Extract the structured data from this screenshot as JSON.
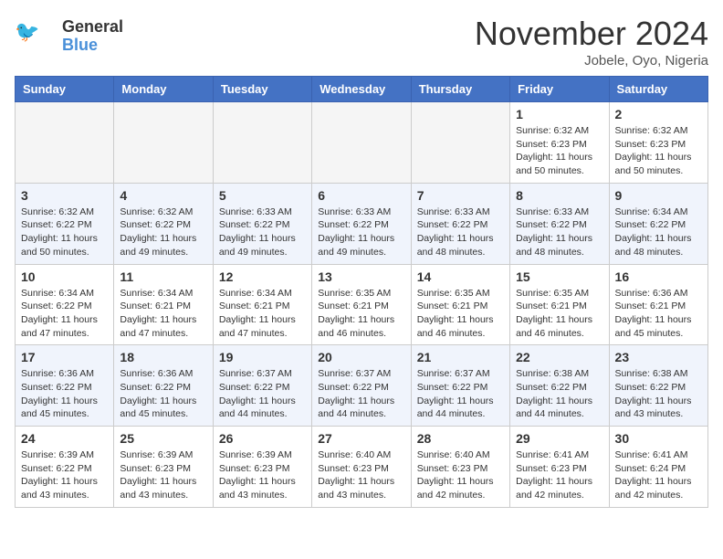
{
  "header": {
    "logo_line1": "General",
    "logo_line2": "Blue",
    "month_title": "November 2024",
    "location": "Jobele, Oyo, Nigeria"
  },
  "weekdays": [
    "Sunday",
    "Monday",
    "Tuesday",
    "Wednesday",
    "Thursday",
    "Friday",
    "Saturday"
  ],
  "weeks": [
    [
      {
        "day": "",
        "empty": true
      },
      {
        "day": "",
        "empty": true
      },
      {
        "day": "",
        "empty": true
      },
      {
        "day": "",
        "empty": true
      },
      {
        "day": "",
        "empty": true
      },
      {
        "day": "1",
        "info": "Sunrise: 6:32 AM\nSunset: 6:23 PM\nDaylight: 11 hours\nand 50 minutes."
      },
      {
        "day": "2",
        "info": "Sunrise: 6:32 AM\nSunset: 6:23 PM\nDaylight: 11 hours\nand 50 minutes."
      }
    ],
    [
      {
        "day": "3",
        "info": "Sunrise: 6:32 AM\nSunset: 6:22 PM\nDaylight: 11 hours\nand 50 minutes."
      },
      {
        "day": "4",
        "info": "Sunrise: 6:32 AM\nSunset: 6:22 PM\nDaylight: 11 hours\nand 49 minutes."
      },
      {
        "day": "5",
        "info": "Sunrise: 6:33 AM\nSunset: 6:22 PM\nDaylight: 11 hours\nand 49 minutes."
      },
      {
        "day": "6",
        "info": "Sunrise: 6:33 AM\nSunset: 6:22 PM\nDaylight: 11 hours\nand 49 minutes."
      },
      {
        "day": "7",
        "info": "Sunrise: 6:33 AM\nSunset: 6:22 PM\nDaylight: 11 hours\nand 48 minutes."
      },
      {
        "day": "8",
        "info": "Sunrise: 6:33 AM\nSunset: 6:22 PM\nDaylight: 11 hours\nand 48 minutes."
      },
      {
        "day": "9",
        "info": "Sunrise: 6:34 AM\nSunset: 6:22 PM\nDaylight: 11 hours\nand 48 minutes."
      }
    ],
    [
      {
        "day": "10",
        "info": "Sunrise: 6:34 AM\nSunset: 6:22 PM\nDaylight: 11 hours\nand 47 minutes."
      },
      {
        "day": "11",
        "info": "Sunrise: 6:34 AM\nSunset: 6:21 PM\nDaylight: 11 hours\nand 47 minutes."
      },
      {
        "day": "12",
        "info": "Sunrise: 6:34 AM\nSunset: 6:21 PM\nDaylight: 11 hours\nand 47 minutes."
      },
      {
        "day": "13",
        "info": "Sunrise: 6:35 AM\nSunset: 6:21 PM\nDaylight: 11 hours\nand 46 minutes."
      },
      {
        "day": "14",
        "info": "Sunrise: 6:35 AM\nSunset: 6:21 PM\nDaylight: 11 hours\nand 46 minutes."
      },
      {
        "day": "15",
        "info": "Sunrise: 6:35 AM\nSunset: 6:21 PM\nDaylight: 11 hours\nand 46 minutes."
      },
      {
        "day": "16",
        "info": "Sunrise: 6:36 AM\nSunset: 6:21 PM\nDaylight: 11 hours\nand 45 minutes."
      }
    ],
    [
      {
        "day": "17",
        "info": "Sunrise: 6:36 AM\nSunset: 6:22 PM\nDaylight: 11 hours\nand 45 minutes."
      },
      {
        "day": "18",
        "info": "Sunrise: 6:36 AM\nSunset: 6:22 PM\nDaylight: 11 hours\nand 45 minutes."
      },
      {
        "day": "19",
        "info": "Sunrise: 6:37 AM\nSunset: 6:22 PM\nDaylight: 11 hours\nand 44 minutes."
      },
      {
        "day": "20",
        "info": "Sunrise: 6:37 AM\nSunset: 6:22 PM\nDaylight: 11 hours\nand 44 minutes."
      },
      {
        "day": "21",
        "info": "Sunrise: 6:37 AM\nSunset: 6:22 PM\nDaylight: 11 hours\nand 44 minutes."
      },
      {
        "day": "22",
        "info": "Sunrise: 6:38 AM\nSunset: 6:22 PM\nDaylight: 11 hours\nand 44 minutes."
      },
      {
        "day": "23",
        "info": "Sunrise: 6:38 AM\nSunset: 6:22 PM\nDaylight: 11 hours\nand 43 minutes."
      }
    ],
    [
      {
        "day": "24",
        "info": "Sunrise: 6:39 AM\nSunset: 6:22 PM\nDaylight: 11 hours\nand 43 minutes."
      },
      {
        "day": "25",
        "info": "Sunrise: 6:39 AM\nSunset: 6:23 PM\nDaylight: 11 hours\nand 43 minutes."
      },
      {
        "day": "26",
        "info": "Sunrise: 6:39 AM\nSunset: 6:23 PM\nDaylight: 11 hours\nand 43 minutes."
      },
      {
        "day": "27",
        "info": "Sunrise: 6:40 AM\nSunset: 6:23 PM\nDaylight: 11 hours\nand 43 minutes."
      },
      {
        "day": "28",
        "info": "Sunrise: 6:40 AM\nSunset: 6:23 PM\nDaylight: 11 hours\nand 42 minutes."
      },
      {
        "day": "29",
        "info": "Sunrise: 6:41 AM\nSunset: 6:23 PM\nDaylight: 11 hours\nand 42 minutes."
      },
      {
        "day": "30",
        "info": "Sunrise: 6:41 AM\nSunset: 6:24 PM\nDaylight: 11 hours\nand 42 minutes."
      }
    ]
  ]
}
